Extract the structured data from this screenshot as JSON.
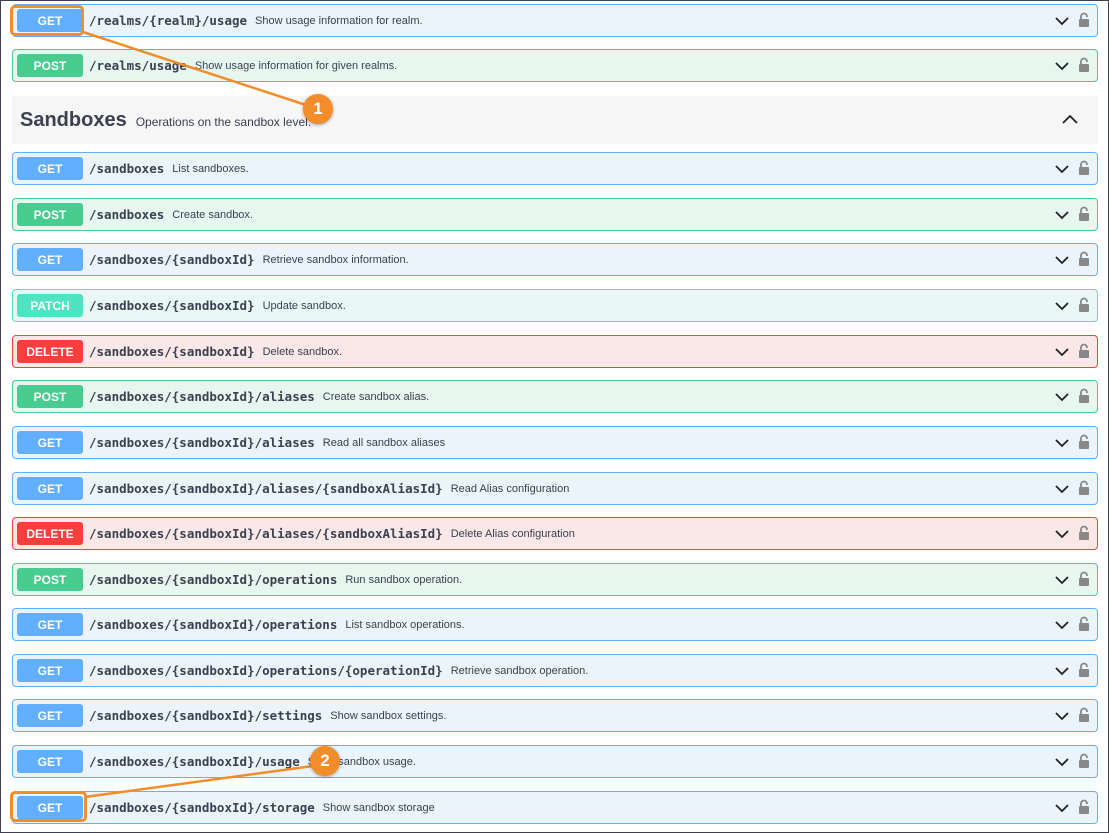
{
  "top_operations": [
    {
      "method": "GET",
      "path": "/realms/{realm}/usage",
      "description": "Show usage information for realm."
    },
    {
      "method": "POST",
      "path": "/realms/usage",
      "description": "Show usage information for given realms."
    }
  ],
  "section": {
    "title": "Sandboxes",
    "description": "Operations on the sandbox level."
  },
  "operations": [
    {
      "method": "GET",
      "path": "/sandboxes",
      "description": "List sandboxes."
    },
    {
      "method": "POST",
      "path": "/sandboxes",
      "description": "Create sandbox."
    },
    {
      "method": "GET",
      "path": "/sandboxes/{sandboxId}",
      "description": "Retrieve sandbox information."
    },
    {
      "method": "PATCH",
      "path": "/sandboxes/{sandboxId}",
      "description": "Update sandbox."
    },
    {
      "method": "DELETE",
      "path": "/sandboxes/{sandboxId}",
      "description": "Delete sandbox."
    },
    {
      "method": "POST",
      "path": "/sandboxes/{sandboxId}/aliases",
      "description": "Create sandbox alias."
    },
    {
      "method": "GET",
      "path": "/sandboxes/{sandboxId}/aliases",
      "description": "Read all sandbox aliases"
    },
    {
      "method": "GET",
      "path": "/sandboxes/{sandboxId}/aliases/{sandboxAliasId}",
      "description": "Read Alias configuration"
    },
    {
      "method": "DELETE",
      "path": "/sandboxes/{sandboxId}/aliases/{sandboxAliasId}",
      "description": "Delete Alias configuration"
    },
    {
      "method": "POST",
      "path": "/sandboxes/{sandboxId}/operations",
      "description": "Run sandbox operation."
    },
    {
      "method": "GET",
      "path": "/sandboxes/{sandboxId}/operations",
      "description": "List sandbox operations."
    },
    {
      "method": "GET",
      "path": "/sandboxes/{sandboxId}/operations/{operationId}",
      "description": "Retrieve sandbox operation."
    },
    {
      "method": "GET",
      "path": "/sandboxes/{sandboxId}/settings",
      "description": "Show sandbox settings."
    },
    {
      "method": "GET",
      "path": "/sandboxes/{sandboxId}/usage",
      "description": "Show sandbox usage."
    },
    {
      "method": "GET",
      "path": "/sandboxes/{sandboxId}/storage",
      "description": "Show sandbox storage"
    }
  ],
  "callouts": [
    "1",
    "2"
  ],
  "colors": {
    "get": "#61affe",
    "post": "#49cc90",
    "patch": "#50e3c2",
    "delete": "#f93e3e",
    "callout": "#f28d2a"
  },
  "icons": {
    "expand": "chevron-down-icon",
    "collapse": "chevron-up-icon",
    "auth": "lock-icon"
  }
}
